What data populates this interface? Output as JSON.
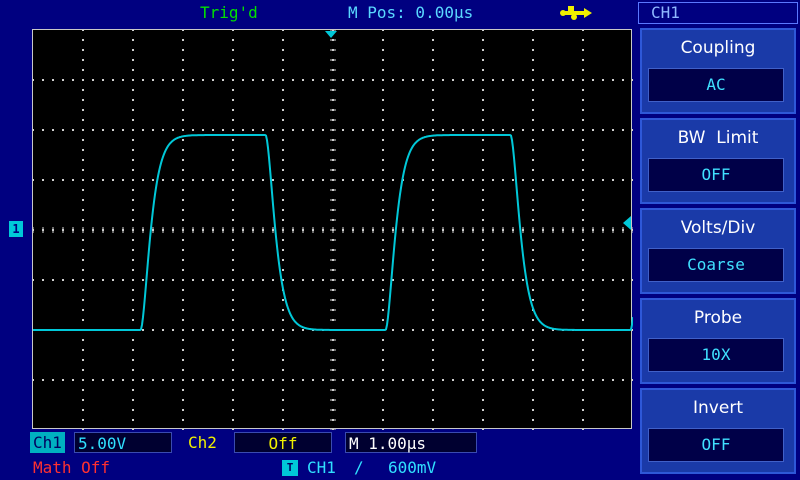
{
  "status": {
    "trig_state": "Trig'd",
    "m_pos": "M Pos: 0.00μs",
    "usb_icon": "usb-icon"
  },
  "display": {
    "channel_marker": "1",
    "trace_color": "#00c8d8",
    "grid_divisions": {
      "x": 12,
      "y": 8
    }
  },
  "waveform": {
    "type": "square",
    "volts_per_div": 5.0,
    "time_per_div_us": 1.0,
    "low_div": -2.0,
    "high_div": 1.9,
    "rise_times_us": [
      -3.85,
      1.05,
      5.95
    ],
    "fall_times_us": [
      -1.35,
      3.55
    ]
  },
  "bottom": {
    "ch1_label": "Ch1",
    "ch1_volts": "5.00V",
    "ch2_label": "Ch2",
    "ch2_value": "Off",
    "timebase": "M 1.00μs",
    "math": "Math Off",
    "trigger_icon": "T",
    "trigger_source": "CH1",
    "trigger_slope": "∕",
    "trigger_level": "600mV"
  },
  "menu": {
    "title": "CH1",
    "items": [
      {
        "label": "Coupling",
        "value": "AC"
      },
      {
        "label": "BW  Limit",
        "value": "OFF"
      },
      {
        "label": "Volts/Div",
        "value": "Coarse"
      },
      {
        "label": "Probe",
        "value": "10X"
      },
      {
        "label": "Invert",
        "value": "OFF"
      }
    ]
  }
}
